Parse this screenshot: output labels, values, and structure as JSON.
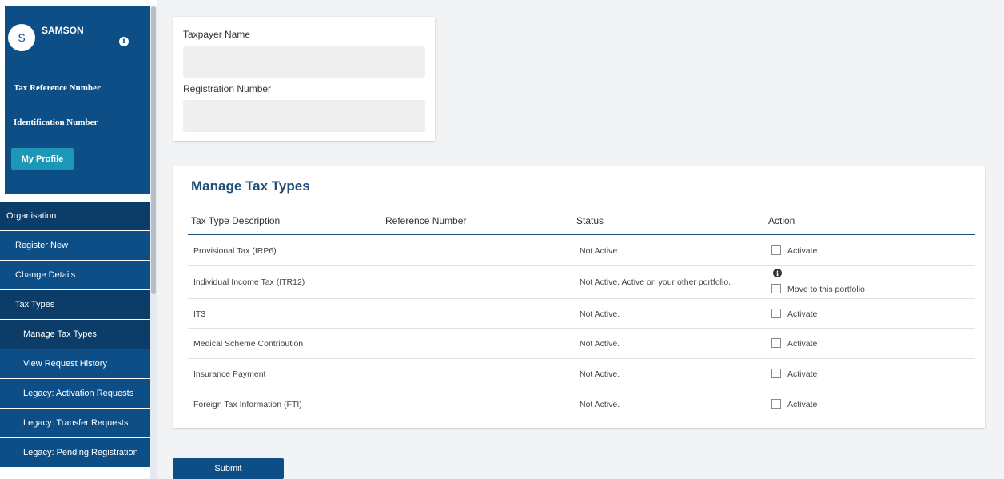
{
  "sidebar": {
    "avatar_initial": "S",
    "user_name": "SAMSON",
    "tax_reference_label": "Tax Reference Number",
    "identification_label": "Identification Number",
    "profile_button": "My Profile",
    "nav": {
      "organisation": "Organisation",
      "register_new": "Register New",
      "change_details": "Change Details",
      "tax_types": "Tax Types",
      "manage_tax_types": "Manage Tax Types",
      "view_request_history": "View Request History",
      "legacy_activation": "Legacy: Activation Requests",
      "legacy_transfer": "Legacy: Transfer Requests",
      "legacy_pending": "Legacy: Pending Registration"
    }
  },
  "taxpayer": {
    "name_label": "Taxpayer Name",
    "name_value": "",
    "registration_label": "Registration Number",
    "registration_value": ""
  },
  "manage": {
    "title": "Manage Tax Types",
    "headers": [
      "Tax Type Description",
      "Reference Number",
      "Status",
      "Action"
    ],
    "rows": [
      {
        "description": "Provisional Tax (IRP6)",
        "reference": "",
        "status": "Not Active.",
        "action": "Activate"
      },
      {
        "description": "Individual Income Tax (ITR12)",
        "reference": "",
        "status": "Not Active. Active on your other portfolio.",
        "action": "Move to this portfolio"
      },
      {
        "description": "IT3",
        "reference": "",
        "status": "Not Active.",
        "action": "Activate"
      },
      {
        "description": "Medical Scheme Contribution",
        "reference": "",
        "status": "Not Active.",
        "action": "Activate"
      },
      {
        "description": "Insurance Payment",
        "reference": "",
        "status": "Not Active.",
        "action": "Activate"
      },
      {
        "description": "Foreign Tax Information (FTI)",
        "reference": "",
        "status": "Not Active.",
        "action": "Activate"
      }
    ],
    "submit": "Submit"
  },
  "icons": {
    "info": "info-icon"
  },
  "colors": {
    "primary": "#0e4e86",
    "accent": "#1b97b8",
    "title": "#1f4e79"
  }
}
